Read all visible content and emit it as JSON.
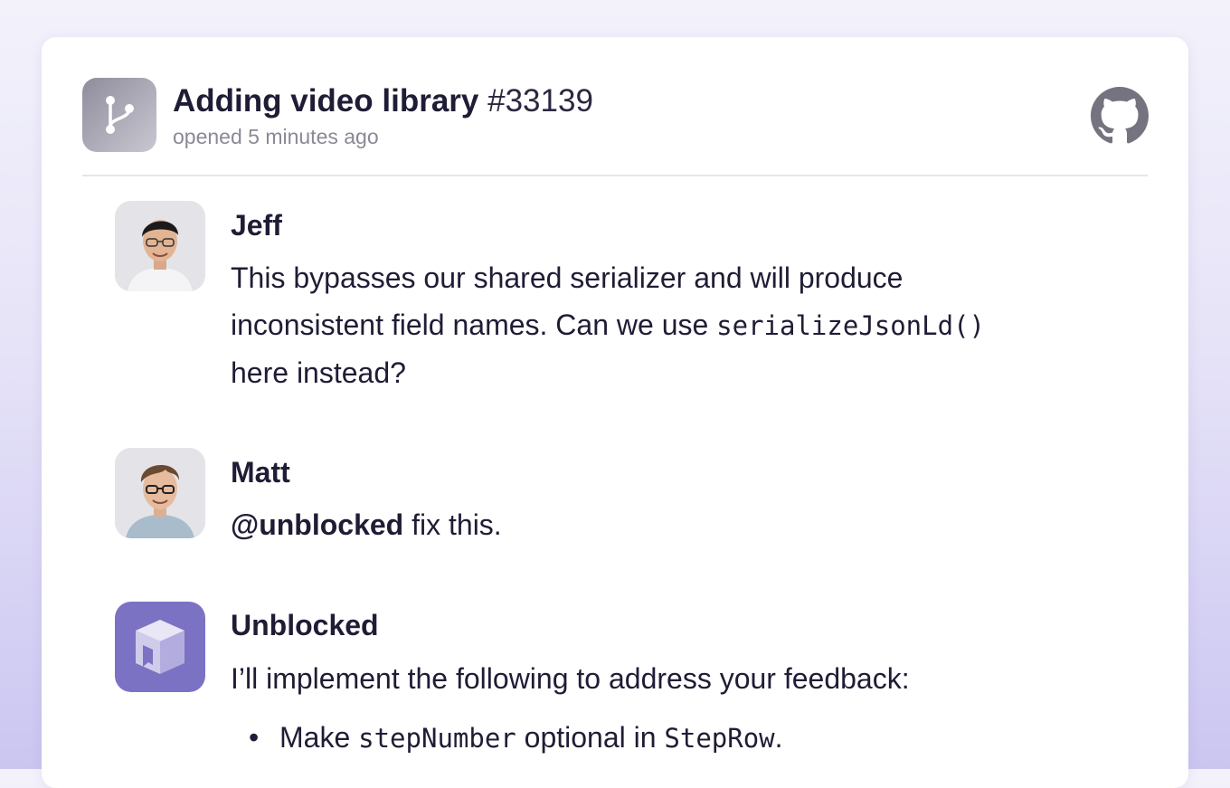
{
  "pr": {
    "title": "Adding video library",
    "number": "#33139",
    "subtitle": "opened 5 minutes ago",
    "icon": "git-branch-icon",
    "platform_icon": "github-icon"
  },
  "comments": [
    {
      "author": "Jeff",
      "lines": [
        "This bypasses our shared serializer and will produce",
        "inconsistent field names. Can we use ",
        "serializeJsonLd()",
        "here instead?"
      ]
    },
    {
      "author": "Matt",
      "mention": "@unblocked",
      "text": " fix this."
    },
    {
      "author": "Unblocked",
      "text": "I’ll implement the following to address your feedback:",
      "bullets": [
        {
          "pre": "Make ",
          "code1": "stepNumber",
          "mid": " optional in ",
          "code2": "StepRow",
          "post": "."
        }
      ]
    }
  ],
  "colors": {
    "bot_accent": "#7c72c3",
    "text": "#1f1d35",
    "muted": "#8a8996"
  }
}
